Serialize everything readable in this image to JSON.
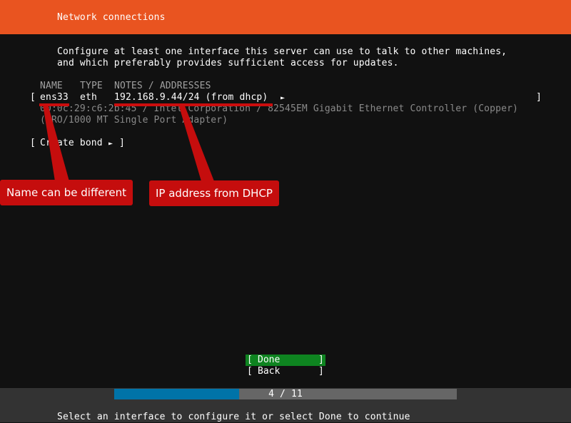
{
  "header": {
    "title": "Network connections"
  },
  "intro": {
    "line1": "Configure at least one interface this server can use to talk to other machines,",
    "line2": "and which preferably provides sufficient access for updates."
  },
  "table": {
    "columns": [
      "NAME",
      "TYPE",
      "NOTES / ADDRESSES"
    ],
    "interfaces": [
      {
        "name": "ens33",
        "type": "eth",
        "address": "192.168.9.44/24 (from dhcp)",
        "arrow": "►",
        "details_line1": "00:0c:29:c6:2b:45 / Intel Corporation / 82545EM Gigabit Ethernet Controller (Copper)",
        "details_line2": "(PRO/1000 MT Single Port Adapter)"
      }
    ],
    "create_bond_label": "Create bond",
    "create_bond_arrow": "►"
  },
  "annotations": {
    "name_note": "Name can be different",
    "ip_note": "IP address from DHCP",
    "color": "#c50d0d"
  },
  "buttons": {
    "done": "Done",
    "back": "Back"
  },
  "progress": {
    "current": 4,
    "total": 11,
    "label": "4 / 11"
  },
  "status_text": "Select an interface to configure it or select Done to continue",
  "colors": {
    "header": "#e95420",
    "done_button": "#0e8420",
    "progress_fill": "#0073a8"
  }
}
